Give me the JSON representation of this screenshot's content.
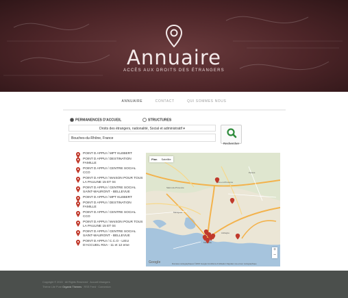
{
  "header": {
    "title": "Annuaire",
    "subtitle": "ACCÈS AUX DROITS DES ÉTRANGERS"
  },
  "nav": {
    "items": [
      "ANNUAIRE",
      "CONTACT",
      "QUI SOMMES NOUS"
    ],
    "active": "ANNUAIRE"
  },
  "search": {
    "radio_permanences": "PERMANENCES D'ACCUEIL",
    "radio_structures": "STRUCTURES",
    "selected_radio": "PERMANENCES D'ACCUEIL",
    "category_select": "Droits des étrangers, nationalité, Social et administratif ▾",
    "address_value": "Bouches-du-Rhône, France",
    "button_label": "Rechercher",
    "button_icon": "search-icon"
  },
  "results": [
    "POINT D APPUI / MPT KLEBERT",
    "POINT D APPUI / DESTINATION FAMILLE",
    "POINT D APPUI / CENTRE SOCIAL CCO",
    "POINT D APPUI / MAISON POUR TOUS LA PAULINE 15 ET 04",
    "POINT D APPUI / CENTRE SOCIAL SAINT-MAURONT - BELLEVUE",
    "POINT D APPUI / MPT KLEBERT",
    "POINT D APPUI / DESTINATION FAMILLE",
    "POINT D APPUI / CENTRE SOCIAL CCO",
    "POINT D APPUI / MAISON POUR TOUS LA PAULINE 15 ET 04",
    "POINT D APPUI / CENTRE SOCIAL SAINT-MAURONT - BELLEVUE",
    "POINT D APPUI / C.C.O - LIEU D'ACCUEIL RSA - 11 et 12 eme"
  ],
  "map": {
    "tab_plan": "Plan",
    "tab_satellite": "Satellite",
    "zoom_in": "+",
    "zoom_out": "−",
    "google": "Google",
    "attribution": "Données cartographiques ©2015 Google   Conditions d'utilisation   Signaler une erreur cartographique",
    "marker_color": "#c0392b"
  },
  "footer": {
    "copyright": "Copyright © 2015 · All Rights Reserved · Accueil étrangers",
    "line2_prefix": "Thème Lite Pure",
    "line2_theme": "Organic Themes",
    "line2_rss": "RSS Feed",
    "line2_login": "Connexion"
  },
  "colors": {
    "hero": "#4d2528",
    "footer": "#4b4f4c",
    "marker": "#c0392b",
    "search_icon": "#2e8b3b"
  }
}
